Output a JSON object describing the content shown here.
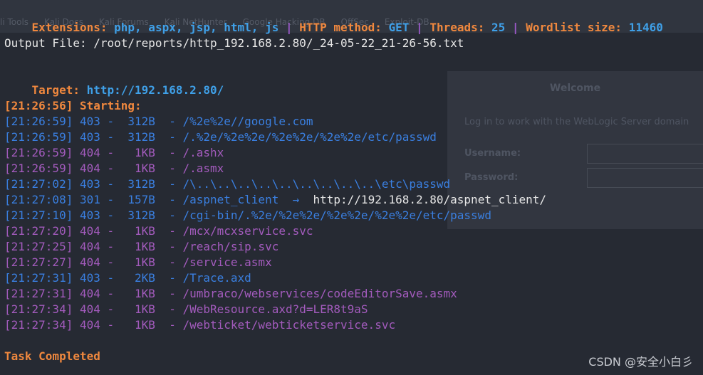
{
  "background_browser": {
    "bookmarks": [
      "li Tools",
      "Kali Docs",
      "Kali Forums",
      "Kali NetHunter",
      "Google Hacking DB",
      "OffSec",
      "Exploit-DB"
    ],
    "dialog": {
      "title": "Welcome",
      "subtitle": "Log in to work with the WebLogic Server domain",
      "username_label": "Username:",
      "password_label": "Password:"
    }
  },
  "header": {
    "ext_label": "Extensions:",
    "ext_value": "php, aspx, jsp, html, js",
    "sep": "|",
    "method_label": "HTTP method:",
    "method_value": "GET",
    "threads_label": "Threads:",
    "threads_value": "25",
    "wordlist_label": "Wordlist size:",
    "wordlist_value": "11460"
  },
  "output_file": "Output File: /root/reports/http_192.168.2.80/_24-05-22_21-26-56.txt",
  "target": {
    "label": "Target:",
    "url": "http://192.168.2.80/"
  },
  "starting": "[21:26:56] Starting:",
  "results": [
    {
      "time": "[21:26:59]",
      "status": "403",
      "size": "312B",
      "path": "/%2e%2e//google.com",
      "redirect": ""
    },
    {
      "time": "[21:26:59]",
      "status": "403",
      "size": "312B",
      "path": "/.%2e/%2e%2e/%2e%2e/%2e%2e/etc/passwd",
      "redirect": ""
    },
    {
      "time": "[21:26:59]",
      "status": "404",
      "size": "1KB",
      "path": "/.ashx",
      "redirect": ""
    },
    {
      "time": "[21:26:59]",
      "status": "404",
      "size": "1KB",
      "path": "/.asmx",
      "redirect": ""
    },
    {
      "time": "[21:27:02]",
      "status": "403",
      "size": "312B",
      "path": "/\\..\\..\\..\\..\\..\\..\\..\\..\\..\\etc\\passwd",
      "redirect": ""
    },
    {
      "time": "[21:27:08]",
      "status": "301",
      "size": "157B",
      "path": "/aspnet_client",
      "redirect": "http://192.168.2.80/aspnet_client/"
    },
    {
      "time": "[21:27:10]",
      "status": "403",
      "size": "312B",
      "path": "/cgi-bin/.%2e/%2e%2e/%2e%2e/%2e%2e/etc/passwd",
      "redirect": ""
    },
    {
      "time": "[21:27:20]",
      "status": "404",
      "size": "1KB",
      "path": "/mcx/mcxservice.svc",
      "redirect": ""
    },
    {
      "time": "[21:27:25]",
      "status": "404",
      "size": "1KB",
      "path": "/reach/sip.svc",
      "redirect": ""
    },
    {
      "time": "[21:27:27]",
      "status": "404",
      "size": "1KB",
      "path": "/service.asmx",
      "redirect": ""
    },
    {
      "time": "[21:27:31]",
      "status": "403",
      "size": "2KB",
      "path": "/Trace.axd",
      "redirect": ""
    },
    {
      "time": "[21:27:31]",
      "status": "404",
      "size": "1KB",
      "path": "/umbraco/webservices/codeEditorSave.asmx",
      "redirect": ""
    },
    {
      "time": "[21:27:34]",
      "status": "404",
      "size": "1KB",
      "path": "/WebResource.axd?d=LER8t9aS",
      "redirect": ""
    },
    {
      "time": "[21:27:34]",
      "status": "404",
      "size": "1KB",
      "path": "/webticket/webticketservice.svc",
      "redirect": ""
    }
  ],
  "task_completed": "Task Completed",
  "watermark": "CSDN @安全小白彡",
  "colors": {
    "orange": "#f0883e",
    "blue": "#3fa0e8",
    "purple": "#9b59c9",
    "status_403": "#3a7fe0",
    "status_404": "#a35bbd",
    "background": "#262a33"
  }
}
